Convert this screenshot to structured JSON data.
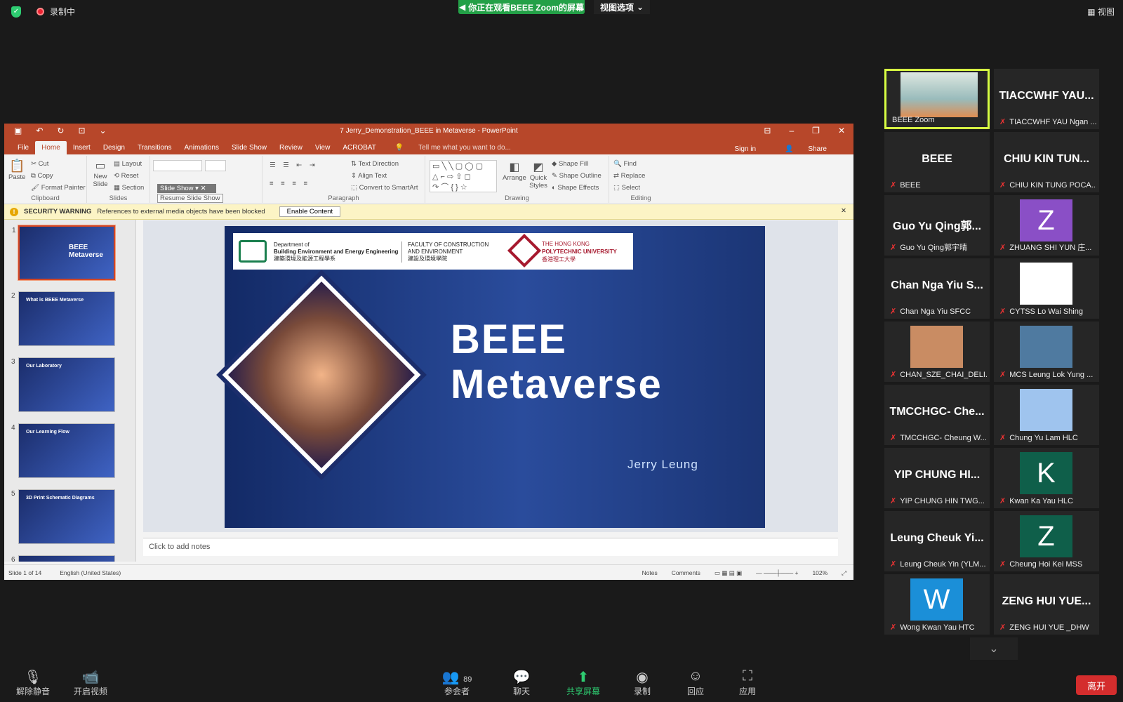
{
  "top": {
    "recording": "录制中",
    "banner": "你正在观看BEEE Zoom的屏幕",
    "view_options": "视图选项",
    "view": "视图"
  },
  "ppt": {
    "title": "7 Jerry_Demonstration_BEEE in Metaverse - PowerPoint",
    "tabs": [
      "File",
      "Home",
      "Insert",
      "Design",
      "Transitions",
      "Animations",
      "Slide Show",
      "Review",
      "View",
      "ACROBAT"
    ],
    "tell": "Tell me what you want to do...",
    "sign_in": "Sign in",
    "share": "Share",
    "ribbon": {
      "paste": "Paste",
      "cut": "Cut",
      "copy": "Copy",
      "format_painter": "Format Painter",
      "clipboard": "Clipboard",
      "new_slide": "New Slide",
      "layout": "Layout",
      "reset": "Reset",
      "section": "Section",
      "slides": "Slides",
      "slide_show": "Slide Show",
      "resume": "Resume Slide Show",
      "text_direction": "Text Direction",
      "align_text": "Align Text",
      "convert": "Convert to SmartArt",
      "paragraph": "Paragraph",
      "arrange": "Arrange",
      "quick_styles": "Quick Styles",
      "shape_fill": "Shape Fill",
      "shape_outline": "Shape Outline",
      "shape_effects": "Shape Effects",
      "drawing": "Drawing",
      "find": "Find",
      "replace": "Replace",
      "select": "Select",
      "editing": "Editing"
    },
    "security": {
      "label": "SECURITY WARNING",
      "message": "References to external media objects have been blocked",
      "button": "Enable Content"
    },
    "thumbs": [
      {
        "n": "1",
        "title": "BEEE Metaverse"
      },
      {
        "n": "2",
        "title": "What is BEEE Metaverse"
      },
      {
        "n": "3",
        "title": "Our Laboratory"
      },
      {
        "n": "4",
        "title": "Our Learning Flow"
      },
      {
        "n": "5",
        "title": "3D Print Schematic Diagrams"
      },
      {
        "n": "6",
        "title": ""
      }
    ],
    "slide": {
      "dept_line1": "Department of",
      "dept_line2": "Building Environment and Energy Engineering",
      "dept_cn": "建築環境及能源工程學系",
      "faculty_line1": "FACULTY OF CONSTRUCTION",
      "faculty_line2": "AND ENVIRONMENT",
      "faculty_cn": "建設及環境學院",
      "univ_small": "THE HONG KONG",
      "univ": "POLYTECHNIC UNIVERSITY",
      "univ_cn": "香港理工大學",
      "title1": "BEEE",
      "title2": "Metaverse",
      "author": "Jerry Leung"
    },
    "notes": "Click to add notes",
    "status": {
      "slide": "Slide 1 of 14",
      "lang": "English (United States)",
      "notes": "Notes",
      "comments": "Comments",
      "zoom": "102%"
    }
  },
  "gallery": [
    {
      "name": "",
      "label": "BEEE Zoom",
      "active": true,
      "muted": false
    },
    {
      "name": "TIACCWHF YAU...",
      "label": "TIACCWHF YAU Ngan ..."
    },
    {
      "name": "BEEE",
      "label": "BEEE"
    },
    {
      "name": "CHIU KIN TUN...",
      "label": "CHIU KIN TUNG POCA..."
    },
    {
      "name": "Guo Yu Qing郭...",
      "label": "Guo Yu Qing郭宇晴"
    },
    {
      "name": "",
      "avatar": "Z",
      "avatar_color": "#8a4fc6",
      "label": "ZHUANG SHI YUN 庄..."
    },
    {
      "name": "Chan Nga Yiu S...",
      "label": "Chan Nga Yiu SFCC"
    },
    {
      "name": "",
      "avatar": "",
      "avatar_color": "#ffffff",
      "label": "CYTSS Lo Wai Shing"
    },
    {
      "name": "",
      "avatar": "",
      "avatar_color": "#c98c63",
      "label": "CHAN_SZE_CHAI_DELI..."
    },
    {
      "name": "",
      "avatar": "",
      "avatar_color": "#4f7aa0",
      "label": "MCS Leung Lok Yung ..."
    },
    {
      "name": "TMCCHGC- Che...",
      "label": "TMCCHGC- Cheung W..."
    },
    {
      "name": "",
      "avatar": "",
      "avatar_color": "#9fc4ee",
      "label": "Chung Yu Lam HLC"
    },
    {
      "name": "YIP CHUNG HI...",
      "label": "YIP CHUNG HIN TWG..."
    },
    {
      "name": "",
      "avatar": "K",
      "avatar_color": "#0f5f4a",
      "label": "Kwan Ka Yau HLC"
    },
    {
      "name": "Leung Cheuk Yi...",
      "label": "Leung Cheuk Yin (YLM..."
    },
    {
      "name": "",
      "avatar": "Z",
      "avatar_color": "#0f5f4a",
      "label": "Cheung Hoi Kei MSS"
    },
    {
      "name": "",
      "avatar": "W",
      "avatar_color": "#1b8fd8",
      "label": "Wong Kwan Yau HTC"
    },
    {
      "name": "ZENG HUI YUE...",
      "label": "ZENG HUI YUE _DHW"
    }
  ],
  "bottom": {
    "unmute": "解除静音",
    "video": "开启视频",
    "participants": "参会者",
    "count": "89",
    "chat": "聊天",
    "share": "共享屏幕",
    "record": "录制",
    "reactions": "回应",
    "apps": "应用",
    "leave": "离开"
  }
}
